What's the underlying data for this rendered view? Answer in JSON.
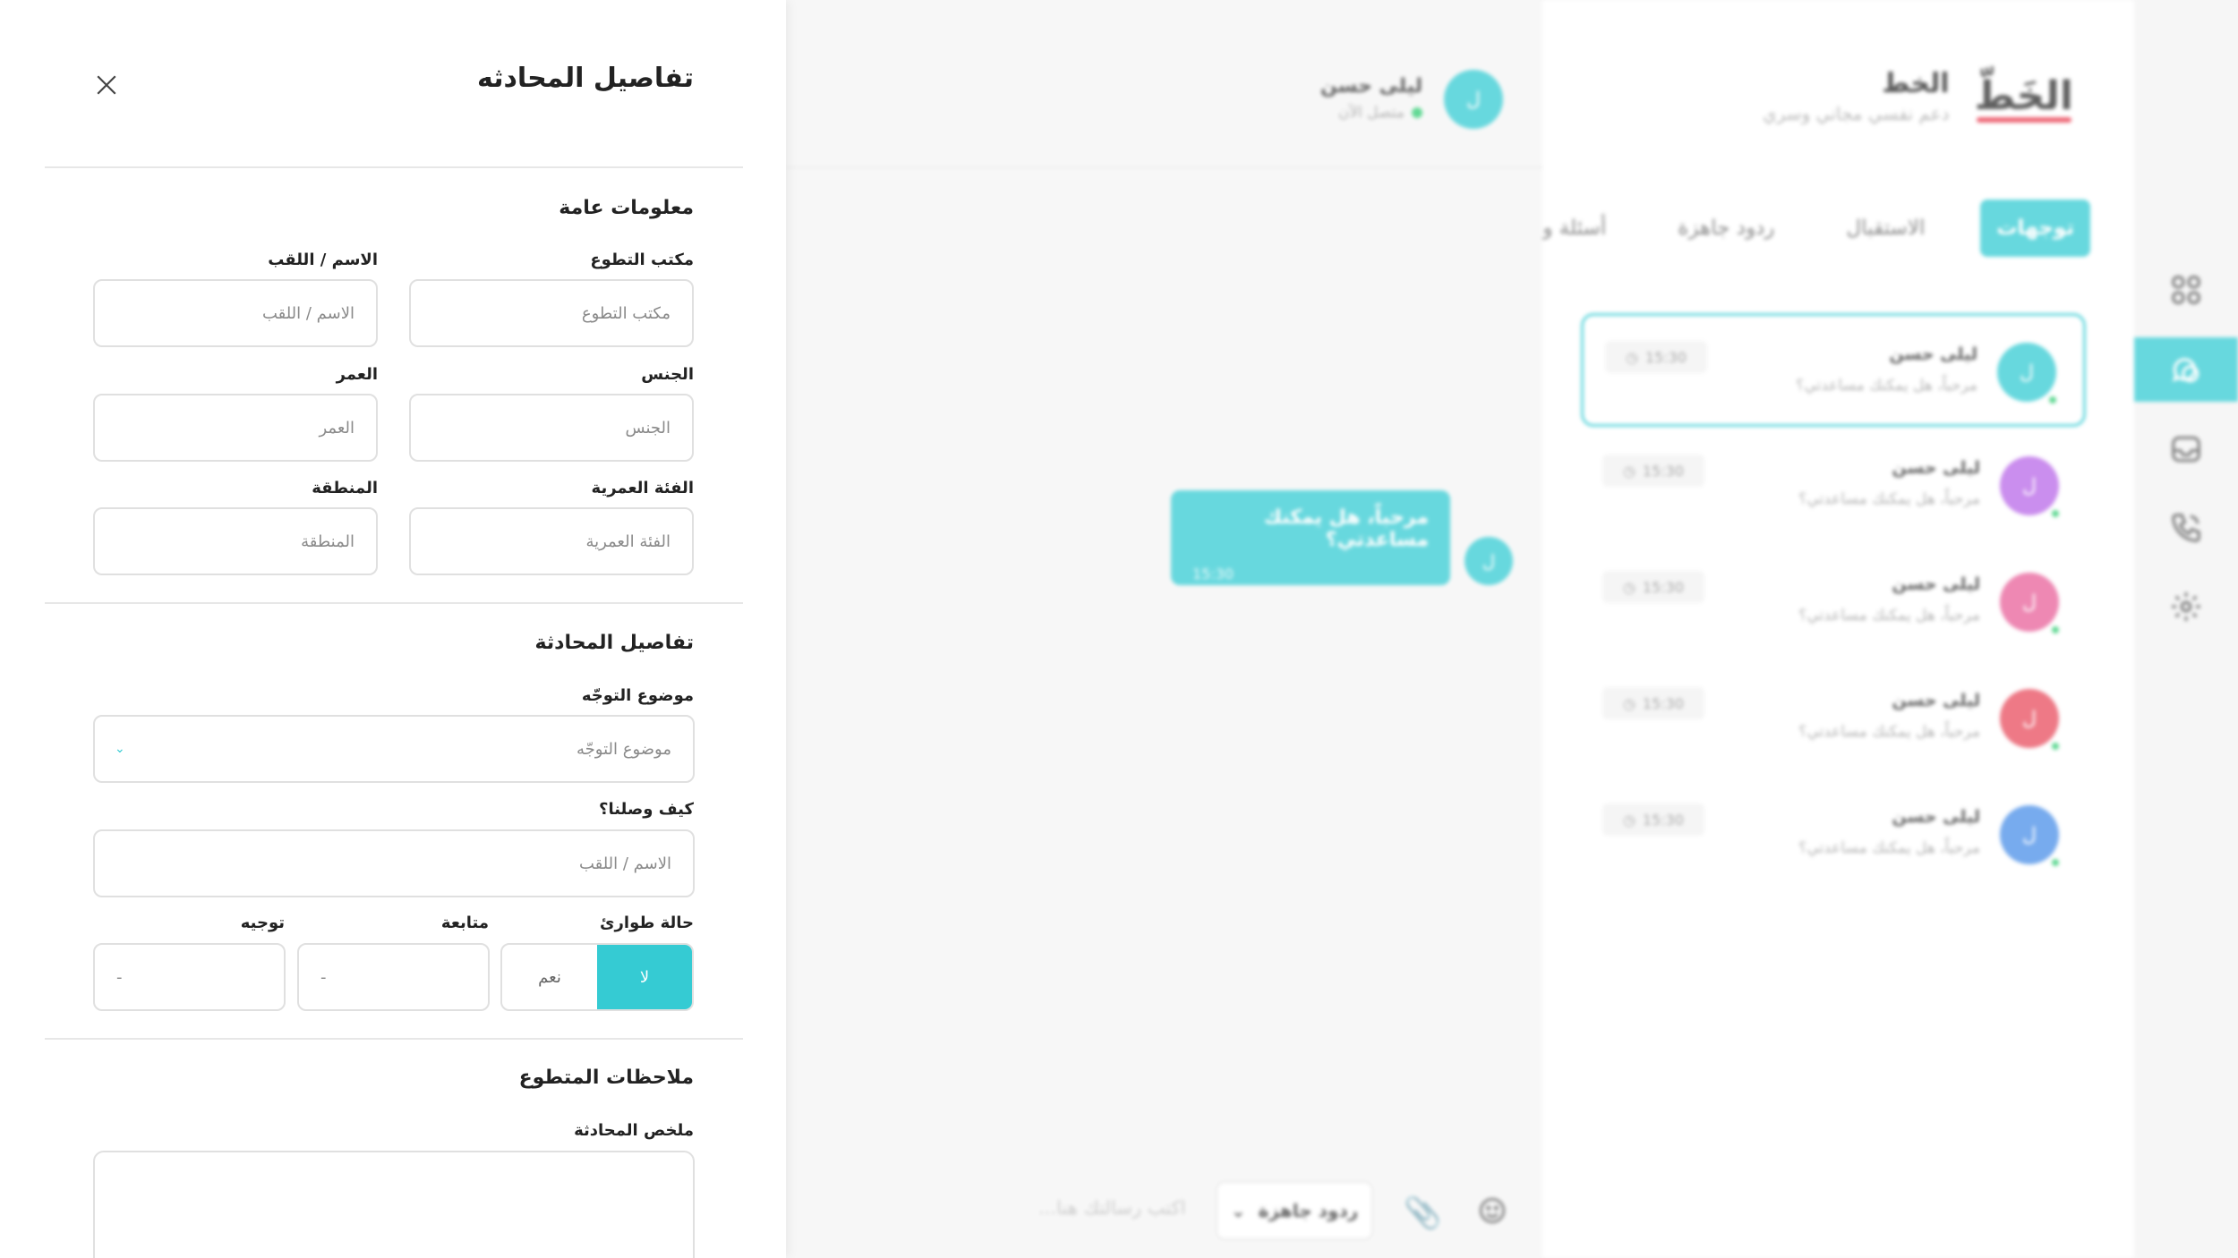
{
  "colors": {
    "accent": "#35cbd3",
    "online": "#2ecc71",
    "brand_red": "#e8364a"
  },
  "sidebar": {
    "icons": [
      {
        "name": "dashboard-grid-icon"
      },
      {
        "name": "chat-bubbles-icon",
        "active": true
      },
      {
        "name": "inbox-icon"
      },
      {
        "name": "phone-call-icon"
      },
      {
        "name": "settings-gear-icon"
      }
    ]
  },
  "brand": {
    "logo": "الخَطّ",
    "title": "الخط",
    "subtitle": "دعم نفسي مجاني وسري"
  },
  "tabs": [
    "توجهات",
    "الاستقبال",
    "ردود جاهزة",
    "أسئلة وأجوبة"
  ],
  "conversations": [
    {
      "initial": "ل",
      "name": "ليلى حسن",
      "message": "مرحباً، هل يمكنك مساعدتي؟",
      "time": "15:30",
      "avatar_color": "#35cbd3",
      "selected": true
    },
    {
      "initial": "ل",
      "name": "ليلى حسن",
      "message": "مرحباً، هل يمكنك مساعدتي؟",
      "time": "15:30",
      "avatar_color": "#b968e8"
    },
    {
      "initial": "ل",
      "name": "ليلى حسن",
      "message": "مرحباً، هل يمكنك مساعدتي؟",
      "time": "15:30",
      "avatar_color": "#e8619a"
    },
    {
      "initial": "ل",
      "name": "ليلى حسن",
      "message": "مرحباً، هل يمكنك مساعدتي؟",
      "time": "15:30",
      "avatar_color": "#e84d5e"
    },
    {
      "initial": "ل",
      "name": "ليلى حسن",
      "message": "مرحباً، هل يمكنك مساعدتي؟",
      "time": "15:30",
      "avatar_color": "#4a8fe8"
    }
  ],
  "chat": {
    "contact_initial": "ل",
    "contact_name": "ليلى حسن",
    "contact_status": "متصل الآن",
    "message": {
      "text": "مرحباً، هل يمكنك مساعدتي؟",
      "time": "15:30",
      "initial": "ل"
    },
    "composer": {
      "placeholder": "اكتب رسالتك هنا...",
      "quick_replies": "ردود جاهزة"
    }
  },
  "drawer": {
    "title": "تفاصيل المحادثه",
    "general": {
      "title": "معلومات عامة",
      "office_label": "مكتب التطوع",
      "office_placeholder": "مكتب التطوع",
      "name_label": "الاسم / اللقب",
      "name_placeholder": "الاسم / اللقب",
      "gender_label": "الجنس",
      "gender_placeholder": "الجنس",
      "age_label": "العمر",
      "age_placeholder": "العمر",
      "age_group_label": "الفئة العمرية",
      "age_group_placeholder": "الفئة العمرية",
      "region_label": "المنطقة",
      "region_placeholder": "المنطقة"
    },
    "conversation": {
      "title": "تفاصيل المحادثة",
      "topic_label": "موضوع التوجّه",
      "topic_value": "موضوع التوجّه",
      "how_label": "كيف وصلنا؟",
      "how_placeholder": "الاسم / اللقب",
      "emergency_label": "حالة طوارئ",
      "emergency_no": "لا",
      "emergency_yes": "نعم",
      "followup_label": "متابعة",
      "followup_value": "-",
      "referral_label": "توجيه",
      "referral_value": "-"
    },
    "notes": {
      "title": "ملاحظات المتطوع",
      "summary_label": "ملخص المحادثة"
    }
  }
}
